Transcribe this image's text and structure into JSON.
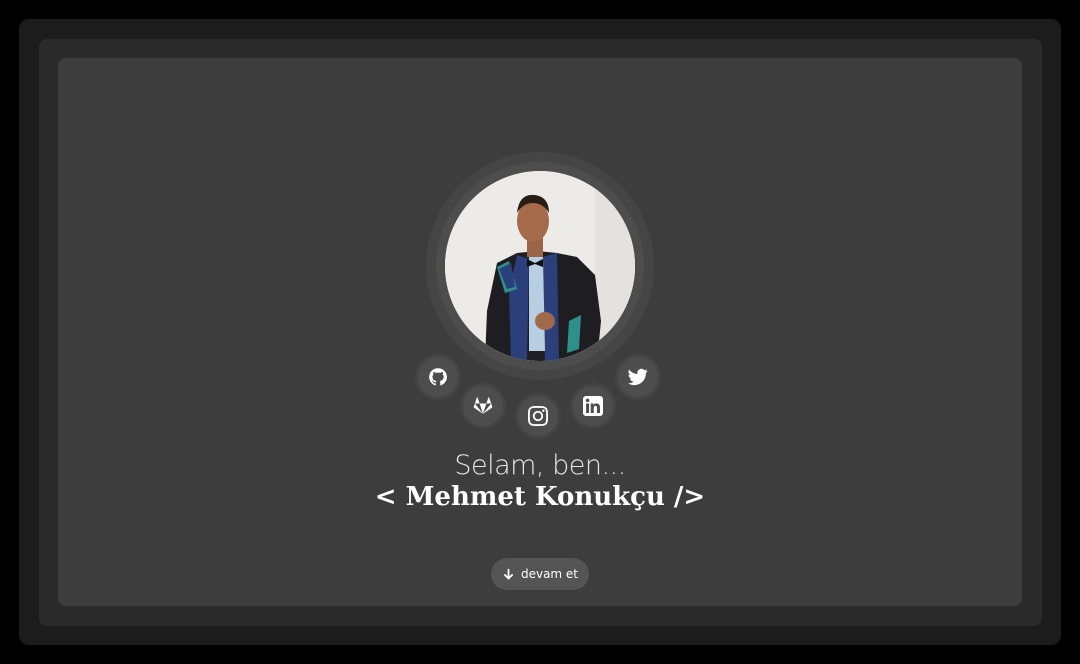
{
  "hero": {
    "greeting": "Selam, ben...",
    "name": "< Mehmet Konukçu />"
  },
  "social": [
    {
      "icon": "github-icon",
      "label": "GitHub"
    },
    {
      "icon": "gitlab-icon",
      "label": "GitLab"
    },
    {
      "icon": "instagram-icon",
      "label": "Instagram"
    },
    {
      "icon": "linkedin-icon",
      "label": "LinkedIn"
    },
    {
      "icon": "twitter-icon",
      "label": "Twitter"
    }
  ],
  "cta": {
    "label": "devam et",
    "icon": "arrow-down-icon"
  },
  "colors": {
    "page_bg": "#000000",
    "card_bg": "#3d3d3d",
    "button_bg": "#545454",
    "text": "#ffffff"
  }
}
